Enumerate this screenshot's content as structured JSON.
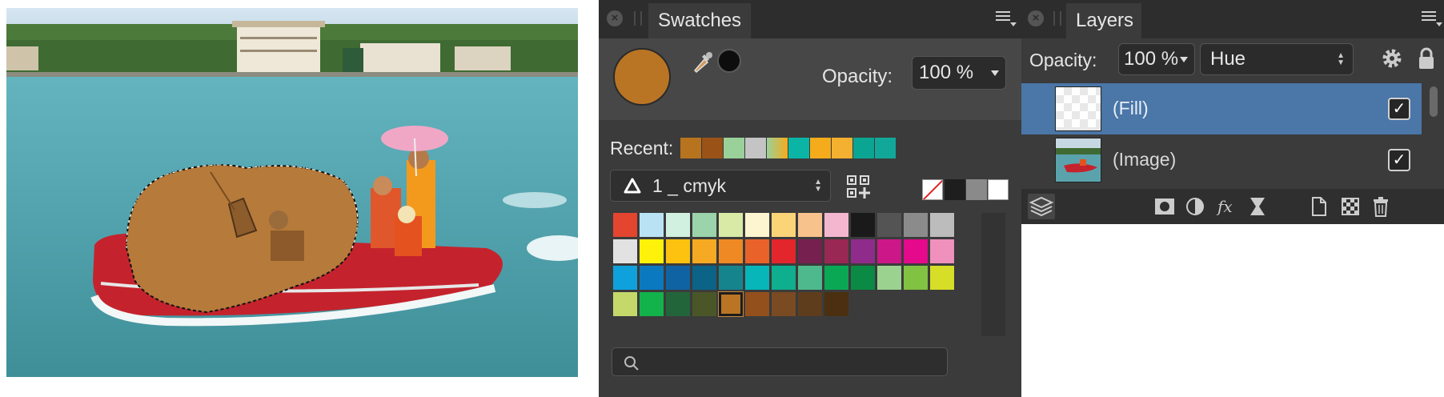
{
  "photo": {
    "description_icon": "photo-canvas"
  },
  "swatches_panel": {
    "tab_label": "Swatches",
    "close_icon": "close-icon",
    "menu_icon": "panel-menu-icon",
    "current_fill_color": "#ba7524",
    "current_stroke_color": "#0d0d0d",
    "opacity_label": "Opacity:",
    "opacity_value": "100 %",
    "recent_label": "Recent:",
    "recent_colors": [
      "#b8731f",
      "#9a5216",
      "#9ad09a",
      "#c4c4c4",
      "gradient",
      "#0ab5a6",
      "#f4ac1c",
      "#f4b030",
      "#0aa593",
      "#12a899"
    ],
    "palette_name": "1 _ cmyk",
    "quick_swatches": [
      "none",
      "#1e1e1e",
      "#8a8a8a",
      "#ffffff"
    ],
    "grid_colors": [
      "#e3452e",
      "#b9e3f4",
      "#d2f0e0",
      "#9bd3aa",
      "#d9eaa6",
      "#fdf4d0",
      "#fcd478",
      "#f8c28d",
      "#f3b6cf",
      "#1a1a1a",
      "#545454",
      "#8b8b8b",
      "#bcbcbc",
      "#e2e2e2",
      "#fef20a",
      "#fcc20f",
      "#f6a922",
      "#ef8923",
      "#e9622a",
      "#e3252c",
      "#762050",
      "#9a2854",
      "#8f2c8b",
      "#cc1789",
      "#e5098b",
      "#ef90bd",
      "#0fa1dc",
      "#0b79c0",
      "#0f63a3",
      "#0b6388",
      "#16848d",
      "#07b6b9",
      "#0eae8e",
      "#4eb98c",
      "#0aa855",
      "#0a8a45",
      "#9bd28f",
      "#82c242",
      "#d6de27",
      "#c5d96b",
      "#12b34a",
      "#23653a",
      "#4a5628",
      "#ba7524",
      "#94501c",
      "#7a4a23",
      "#5e3d1d",
      "#4a3010"
    ],
    "selected_index": 43,
    "search_placeholder": ""
  },
  "layers_panel": {
    "tab_label": "Layers",
    "opacity_label": "Opacity:",
    "opacity_value": "100 %",
    "blend_mode": "Hue",
    "layers": [
      {
        "name": "(Fill)",
        "visible": true,
        "selected": true
      },
      {
        "name": "(Image)",
        "visible": true,
        "selected": false
      }
    ],
    "bottom_icons": [
      "layers-stack-icon",
      "mask-icon",
      "adjustment-icon",
      "fx-icon",
      "live-filter-icon",
      "new-document-icon",
      "pixel-layer-icon",
      "trash-icon"
    ]
  }
}
